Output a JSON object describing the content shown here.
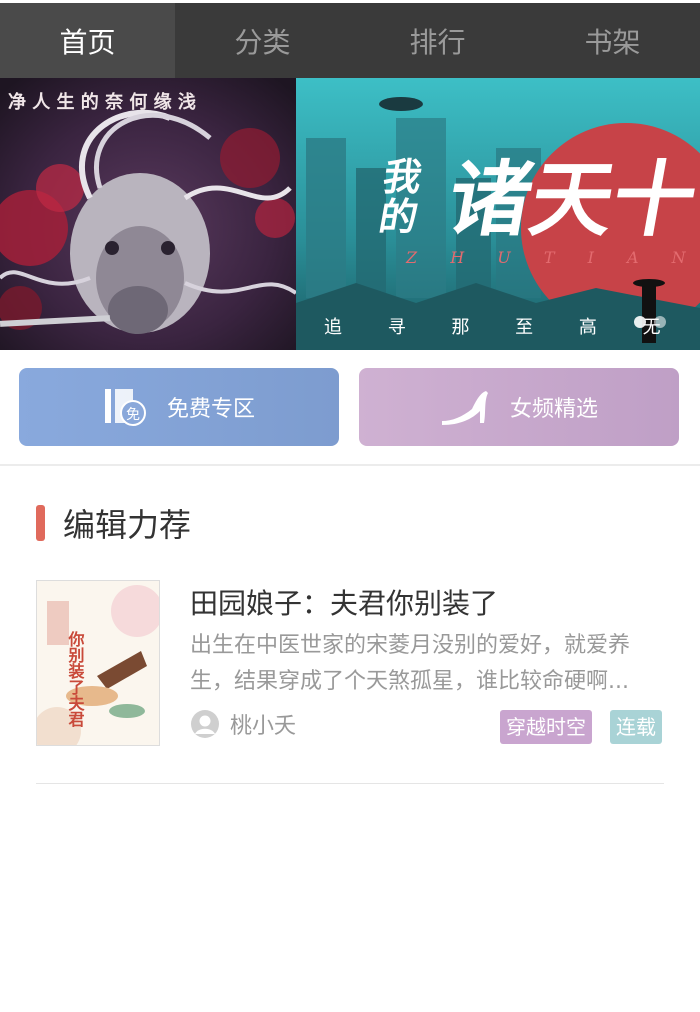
{
  "nav": {
    "tabs": [
      {
        "label": "首页",
        "active": true
      },
      {
        "label": "分类",
        "active": false
      },
      {
        "label": "排行",
        "active": false
      },
      {
        "label": "书架",
        "active": false
      }
    ]
  },
  "banner": {
    "slides": [
      {
        "text": "净 人 生 的 奈 何 缘 浅"
      },
      {
        "title_line1": "我",
        "title_line2": "的",
        "title_big": "诸天十",
        "pinyin": "Z H U T I A N S H",
        "bottom_text": "追  寻  那  至  高  无"
      }
    ],
    "active_dot": 0,
    "dot_count": 2
  },
  "entries": {
    "free": {
      "label": "免费专区",
      "icon": "free-book-icon",
      "badge": "免"
    },
    "female": {
      "label": "女频精选",
      "icon": "high-heel-icon"
    }
  },
  "section": {
    "title": "编辑力荐",
    "accent": "#e06a5c"
  },
  "book": {
    "title": "田园娘子：夫君你别装了",
    "description": "出生在中医世家的宋菱月没别的爱好，就爱养生，结果穿成了个天煞孤星，谁比较命硬啊...",
    "author": "桃小夭",
    "tags": [
      "穿越时空",
      "连载"
    ],
    "cover_text": "你别装了夫君"
  }
}
